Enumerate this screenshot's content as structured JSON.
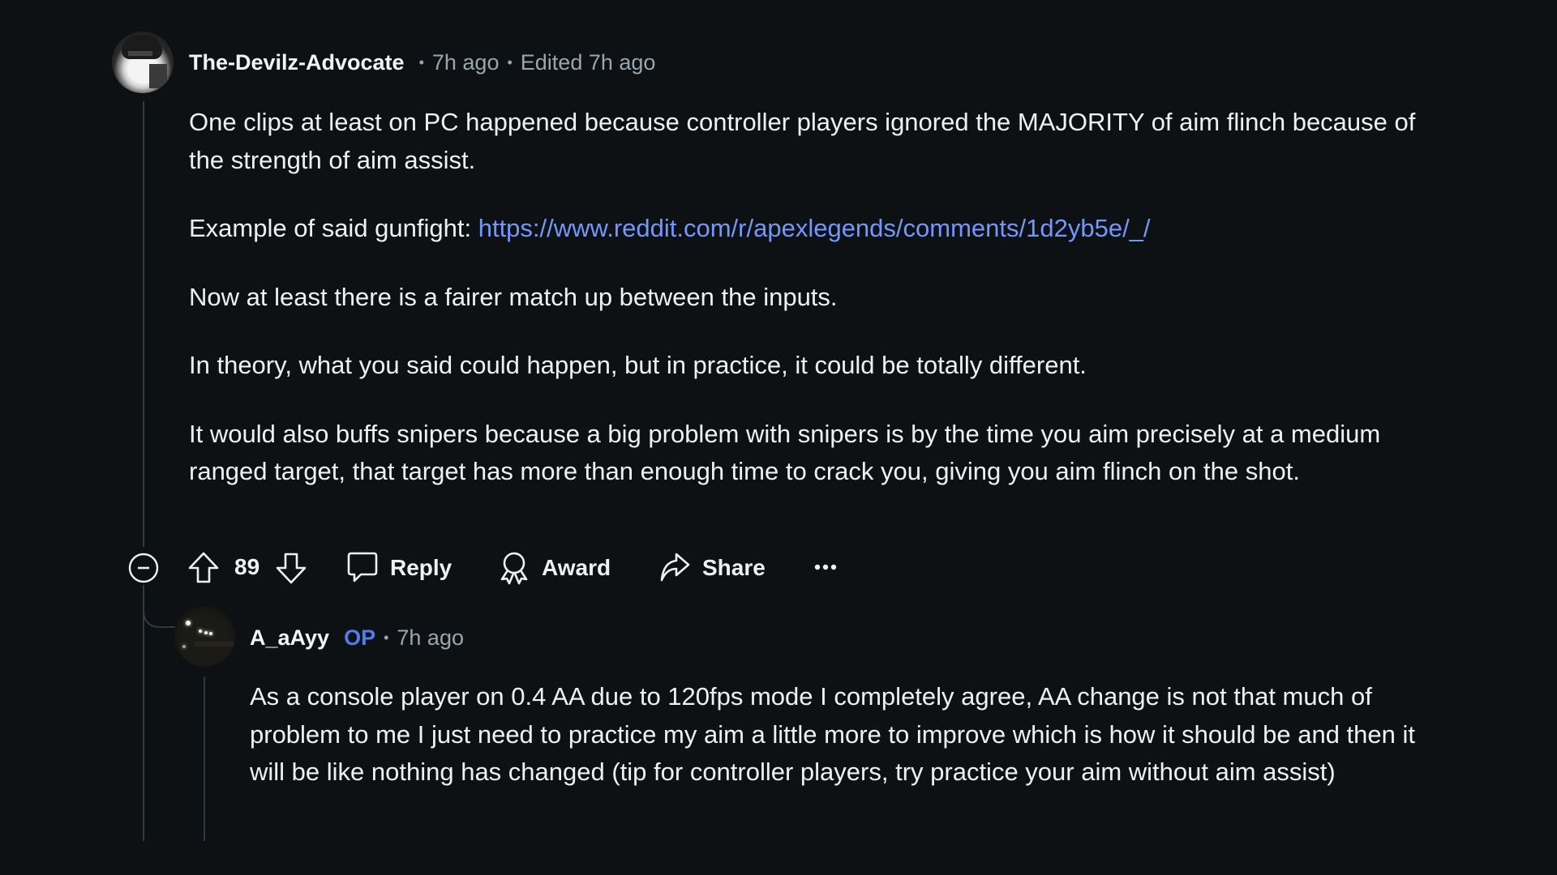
{
  "comment": {
    "author": "The-Devilz-Advocate",
    "time": "7h ago",
    "edited": "Edited 7h ago",
    "avatar_icon": "user-avatar-anime",
    "paragraphs": [
      {
        "text": "One clips at least on PC happened because controller players ignored the MAJORITY of aim flinch because of the strength of aim assist."
      },
      {
        "prefix": "Example of said gunfight: ",
        "link": "https://www.reddit.com/r/apexlegends/comments/1d2yb5e/_/"
      },
      {
        "text": "Now at least there is a fairer match up between the inputs."
      },
      {
        "text": "In theory, what you said could happen, but in practice, it could be totally different."
      },
      {
        "text": "It would also buffs snipers because a big problem with snipers is by the time you aim precisely at a medium ranged target, that target has more than enough time to crack you, giving you aim flinch on the shot."
      }
    ],
    "actions": {
      "votes": "89",
      "reply": "Reply",
      "award": "Award",
      "share": "Share",
      "more": "···"
    }
  },
  "reply": {
    "author": "A_aAyy",
    "badge": "OP",
    "time": "7h ago",
    "avatar_icon": "user-avatar-night",
    "text": "As a console player on 0.4 AA due to 120fps mode I completely agree, AA change is not that much of problem to me I just need to practice my aim a little more to improve which is how it should be and then it will be like nothing has changed (tip for controller players, try practice your aim without aim assist)"
  },
  "colors": {
    "background": "#0e1113",
    "text": "#eef1f3",
    "meta": "#9aa6ae",
    "link": "#7397ff",
    "op_badge": "#4f7df0",
    "thread_line": "#33393d"
  },
  "sep": "•"
}
